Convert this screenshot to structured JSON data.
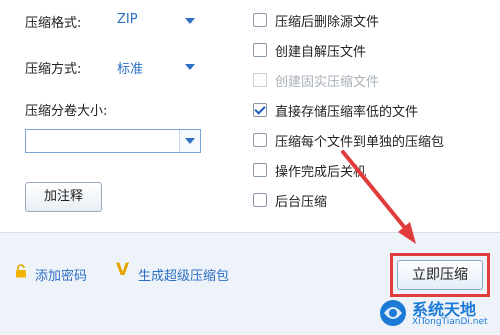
{
  "left": {
    "format_label": "压缩格式:",
    "format_value": "ZIP",
    "method_label": "压缩方式:",
    "method_value": "标准",
    "split_label": "压缩分卷大小:",
    "split_value": "",
    "comment_button": "加注释"
  },
  "options": [
    {
      "label": "压缩后删除源文件",
      "checked": false,
      "disabled": false
    },
    {
      "label": "创建自解压文件",
      "checked": false,
      "disabled": false
    },
    {
      "label": "创建固实压缩文件",
      "checked": false,
      "disabled": true
    },
    {
      "label": "直接存储压缩率低的文件",
      "checked": true,
      "disabled": false
    },
    {
      "label": "压缩每个文件到单独的压缩包",
      "checked": false,
      "disabled": false
    },
    {
      "label": "操作完成后关机",
      "checked": false,
      "disabled": false
    },
    {
      "label": "后台压缩",
      "checked": false,
      "disabled": false
    }
  ],
  "bottom": {
    "add_password": "添加密码",
    "super_archive": "生成超级压缩包",
    "compress_now": "立即压缩"
  },
  "watermark": {
    "title": "系统天地",
    "url": "XiTongTianDi.net"
  },
  "colors": {
    "accent": "#2d6fc4",
    "highlight": "#e23b3b"
  }
}
